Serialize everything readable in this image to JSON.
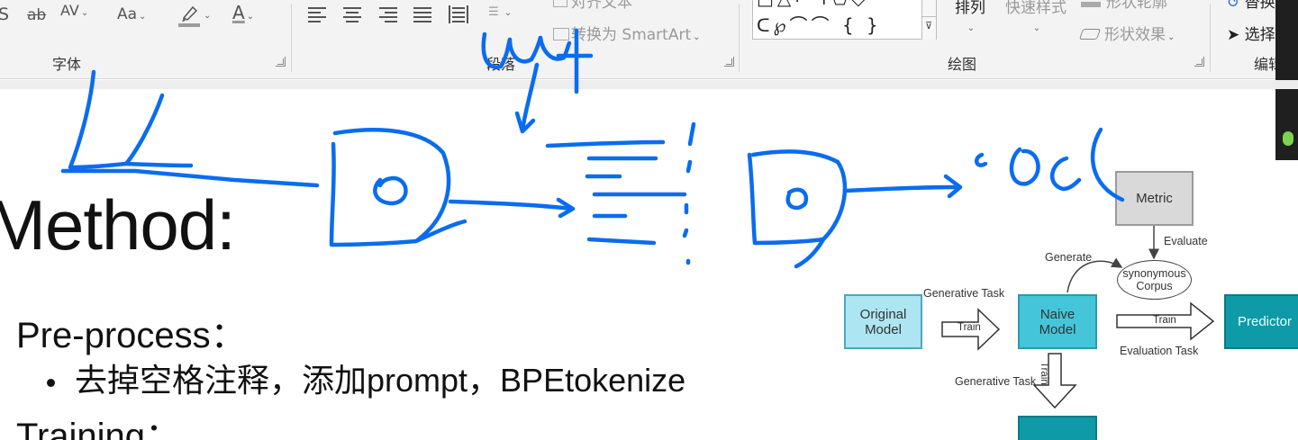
{
  "ribbon": {
    "font_group": {
      "label": "字体",
      "strike_glyph": "ab",
      "spacing_glyph": "AV",
      "case_glyph": "Aa",
      "font_color_glyph": "A",
      "highlight_icon": "highlighter-icon"
    },
    "paragraph_group": {
      "label": "段落",
      "smartart_label": "转换为 SmartArt",
      "align_text_label": "对齐文本"
    },
    "drawing_group": {
      "label": "绘图",
      "arrange_label": "排列",
      "quick_styles_label": "快速样式",
      "shape_outline_label": "形状轮廓",
      "shape_effects_label": "形状效果",
      "shapes_row_1": "□△⌐↰⬠◇",
      "shapes_row_2": "ᑕ℘⌒⌒ { }"
    },
    "editing_group": {
      "label": "编辑",
      "select_label": "选择",
      "replace_label": "替换"
    }
  },
  "slide": {
    "title": "Method:",
    "preprocess_heading": "Pre-process：",
    "preprocess_bullet": "去掉空格注释，添加prompt，BPEtokenize",
    "training_heading": "Training："
  },
  "diagram": {
    "metric": "Metric",
    "evaluate": "Evaluate",
    "generate": "Generate",
    "synonymous_corpus_1": "synonymous",
    "synonymous_corpus_2": "Corpus",
    "original_model_1": "Original",
    "original_model_2": "Model",
    "generative_task_top": "Generative Task",
    "train_1": "Train",
    "naive_model_1": "Naive",
    "naive_model_2": "Model",
    "train_2": "Train",
    "predictor": "Predictor",
    "evaluation_task": "Evaluation Task",
    "generative_task_bottom": "Generative Task",
    "train_3": "Train"
  },
  "colors": {
    "ink": "#0a6cf0",
    "original_model_fill": "#ade6f2",
    "naive_model_fill": "#44c5da",
    "predictor_fill": "#0e9aa7",
    "metric_fill": "#d9d9d9"
  }
}
